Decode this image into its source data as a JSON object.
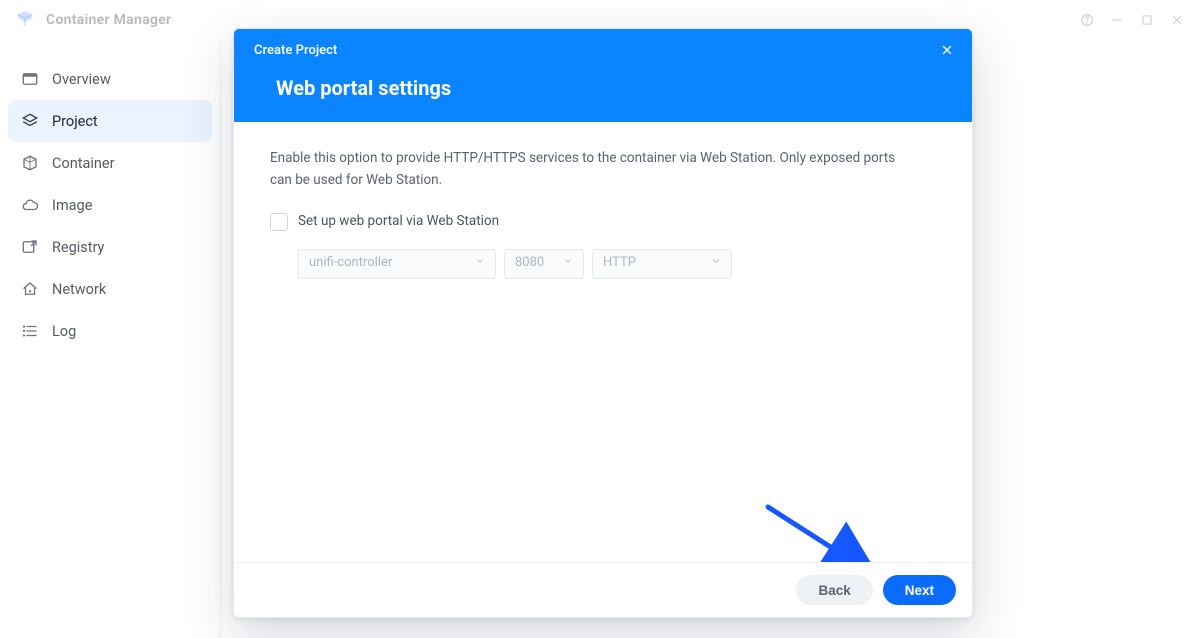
{
  "titlebar": {
    "app_name": "Container Manager"
  },
  "sidebar": {
    "items": [
      {
        "label": "Overview"
      },
      {
        "label": "Project"
      },
      {
        "label": "Container"
      },
      {
        "label": "Image"
      },
      {
        "label": "Registry"
      },
      {
        "label": "Network"
      },
      {
        "label": "Log"
      }
    ],
    "active_index": 1
  },
  "modal": {
    "header_small": "Create Project",
    "header_title": "Web portal settings",
    "description": "Enable this option to provide HTTP/HTTPS services to the container via Web Station. Only exposed ports can be used for Web Station.",
    "checkbox_label": "Set up web portal via Web Station",
    "checkbox_checked": false,
    "selects": {
      "container": "unifi-controller",
      "port": "8080",
      "protocol": "HTTP"
    },
    "buttons": {
      "back": "Back",
      "next": "Next"
    }
  },
  "icons": {
    "overview": "overview-icon",
    "project": "layers-icon",
    "container": "cube-icon",
    "image": "cloud-icon",
    "registry": "window-arrow-icon",
    "network": "home-network-icon",
    "log": "list-icon"
  },
  "colors": {
    "accent": "#0a84ff",
    "primary_button": "#0a6cff",
    "sidebar_active_bg": "#eaf3ff",
    "arrow": "#1558ff"
  }
}
